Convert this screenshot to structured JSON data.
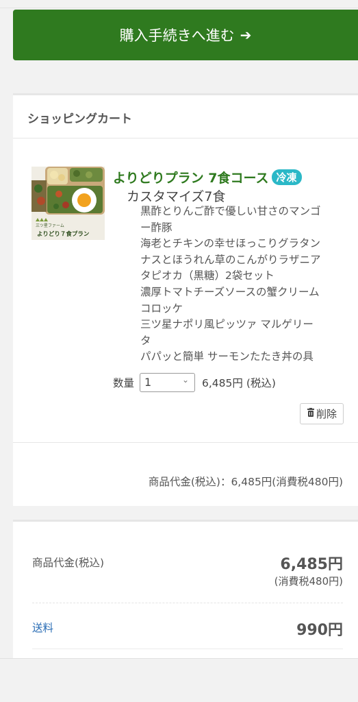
{
  "checkout": {
    "label": "購入手続きへ進む",
    "arrow": "➔"
  },
  "cart": {
    "header": "ショッピングカート",
    "item": {
      "image": {
        "brand_text": "三ツ星ファーム",
        "caption": "よりどり７食プラン"
      },
      "title": "よりどりプラン 7食コース",
      "badge": "冷凍",
      "subtitle": "カスタマイズ7食",
      "menu_lines": [
        "黒酢とりんご酢で優しい甘さのマンゴ",
        "ー酢豚",
        "海老とチキンの幸せほっこりグラタン",
        "ナスとほうれん草のこんがりラザニア",
        "タピオカ（黒糖）2袋セット",
        "濃厚トマトチーズソースの蟹クリーム",
        "コロッケ",
        "三ツ星ナポリ風ピッツァ マルゲリー",
        "タ",
        "パパッと簡単 サーモンたたき丼の具"
      ],
      "quantity_label": "数量",
      "quantity_value": "1",
      "price": "6,485円 (税込)",
      "delete_label": "削除"
    },
    "subtotal_line": "商品代金(税込)：6,485円(消費税480円)"
  },
  "summary": {
    "items_label": "商品代金(税込)",
    "items_value": "6,485円",
    "items_tax": "(消費税480円)",
    "shipping_label": "送料",
    "shipping_value": "990円"
  },
  "colors": {
    "primary_green": "#2f7a1f",
    "badge_teal": "#2bb8c7",
    "link_blue": "#2a6db5"
  }
}
